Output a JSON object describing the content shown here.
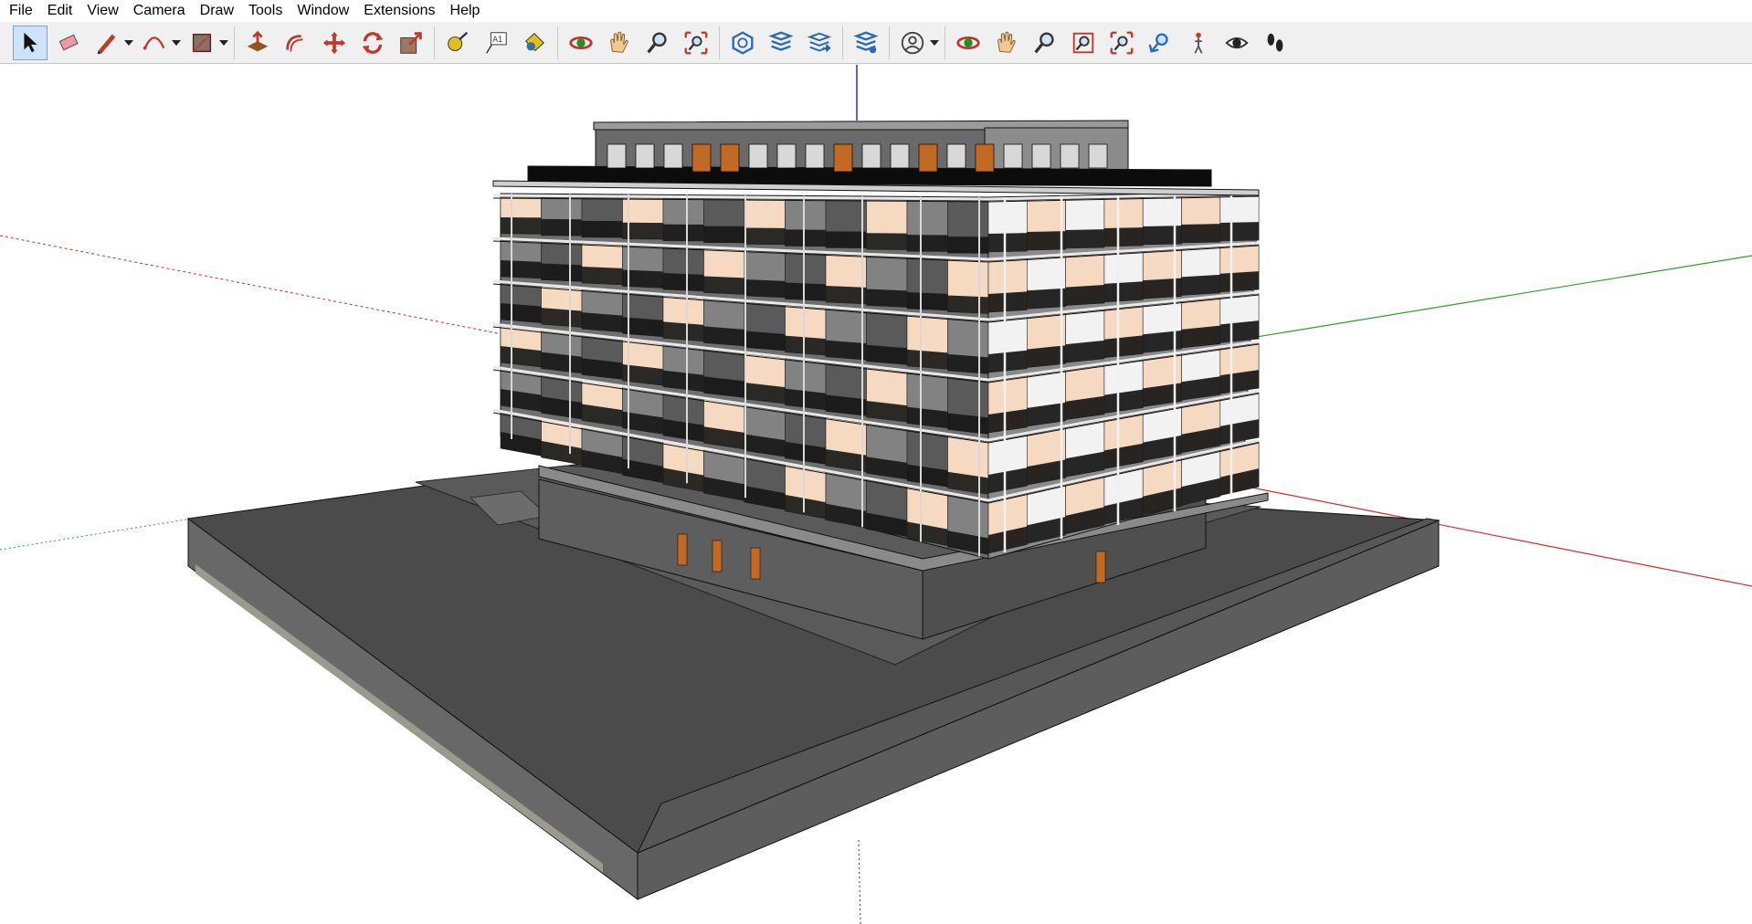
{
  "menu": [
    "File",
    "Edit",
    "View",
    "Camera",
    "Draw",
    "Tools",
    "Window",
    "Extensions",
    "Help"
  ],
  "toolbar": {
    "groups": [
      [
        "select-icon",
        "eraser-icon",
        "pencil-line-icon",
        "arc-icon",
        "rectangle-icon"
      ],
      [
        "push-pull-icon",
        "offset-icon",
        "move-icon",
        "rotate-icon",
        "scale-icon"
      ],
      [
        "tape-measure-icon",
        "text-label-icon",
        "paint-bucket-icon"
      ],
      [
        "orbit-icon",
        "pan-hand-icon",
        "zoom-icon",
        "zoom-extents-icon"
      ],
      [
        "warehouse-icon",
        "extension-warehouse-icon",
        "send-to-layout-icon"
      ],
      [
        "extension-manager-icon"
      ],
      [
        "account-icon"
      ],
      [
        "orbit-icon-2",
        "pan-hand-icon-2",
        "zoom-icon-2",
        "zoom-window-icon",
        "zoom-extents-icon-2",
        "previous-view-icon",
        "position-camera-icon",
        "look-around-icon",
        "walk-icon"
      ]
    ],
    "active_tool": "select-icon"
  },
  "colors": {
    "axis_red": "#d42a2a",
    "axis_green": "#2aa02a",
    "axis_blue": "#2a2ad4",
    "base_top": "#4b4b4b",
    "base_side": "#676767",
    "facade_glass": "#707070",
    "panel_peach": "#f5d9c0",
    "balcony_black": "#151515",
    "door_orange": "#c26a24"
  }
}
